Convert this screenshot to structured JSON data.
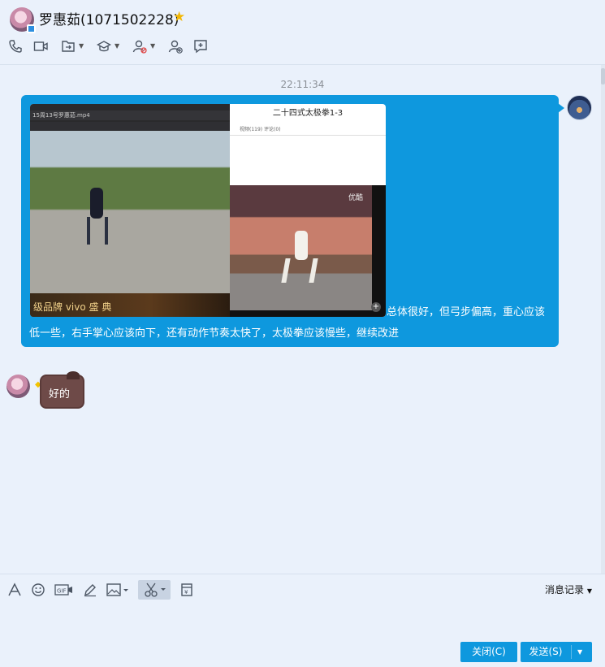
{
  "contact": {
    "name": "罗惠茹(1071502228)",
    "avatar_icon": "avatar-icon",
    "star_icon": "star-icon"
  },
  "header_toolbar": [
    {
      "name": "phone-icon"
    },
    {
      "name": "video-camera-icon"
    },
    {
      "name": "share-screen-icon"
    },
    {
      "name": "remote-assist-icon"
    },
    {
      "name": "block-user-icon"
    },
    {
      "name": "add-user-icon"
    },
    {
      "name": "add-group-icon"
    }
  ],
  "chat": {
    "time": "22:11:34",
    "image_message": {
      "player_title": "15周13号罗惠茹.mp4",
      "web_title": "二十四式太极拳1-3",
      "web_tabs": "视频(119)        评论(0)",
      "right_video_logo": "优酷",
      "banner_text": "级品牌 vivo 盛 典"
    },
    "message_text": "总体很好，但弓步偏高，重心应该低一些，右手掌心应该向下，还有动作节奏太快了，太极拳应该慢些，继续改进",
    "reply_text": "好的"
  },
  "input_toolbar": [
    {
      "name": "font-icon"
    },
    {
      "name": "emoji-icon"
    },
    {
      "name": "gif-icon"
    },
    {
      "name": "pen-icon"
    },
    {
      "name": "image-icon"
    },
    {
      "name": "scissors-icon"
    },
    {
      "name": "red-packet-icon"
    }
  ],
  "input": {
    "history_label": "消息记录",
    "close_label": "关闭(C)",
    "send_label": "发送(S)"
  },
  "colors": {
    "accent": "#0e98de",
    "background": "#eaf1fb",
    "reply_bubble": "#6e4a48"
  }
}
